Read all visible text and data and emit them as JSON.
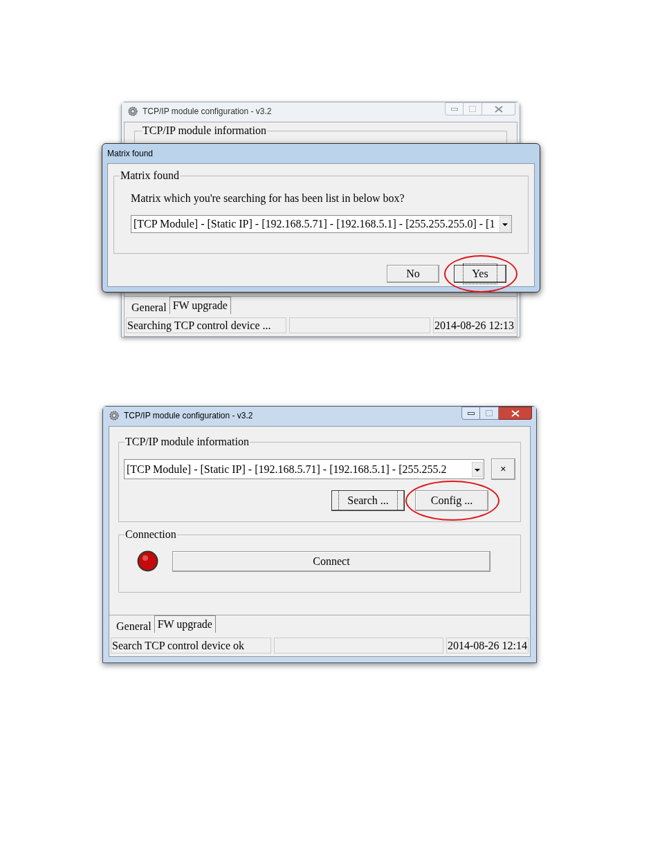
{
  "screenshot_1": {
    "window": {
      "title": "TCP/IP module configuration - v3.2",
      "active": false
    },
    "group_title": "TCP/IP module information",
    "dialog": {
      "title": "Matrix found",
      "group_title": "Matrix found",
      "message": "Matrix which you're searching for has been list in below box?",
      "dropdown_value": "[TCP Module] - [Static IP] - [192.168.5.71] - [192.168.5.1] - [255.255.255.0] - [1",
      "buttons": [
        {
          "label": "No",
          "focused": false,
          "highlighted": false
        },
        {
          "label": "Yes",
          "focused": true,
          "highlighted": true
        }
      ]
    },
    "tabs": [
      {
        "label": "General",
        "selected": true
      },
      {
        "label": "FW upgrade",
        "selected": false
      }
    ],
    "status_bar": {
      "message": "Searching TCP control device ...",
      "time": "2014-08-26 12:13"
    }
  },
  "screenshot_2": {
    "window": {
      "title": "TCP/IP module configuration - v3.2",
      "active": true
    },
    "info_group": {
      "title": "TCP/IP module information",
      "dropdown_value": "[TCP Module] - [Static IP] - [192.168.5.71] - [192.168.5.1] - [255.255.2",
      "clear_button": "×",
      "buttons": [
        {
          "label": "Search ...",
          "focused": true,
          "highlighted": false
        },
        {
          "label": "Config ...",
          "focused": false,
          "highlighted": true
        }
      ]
    },
    "connection_group": {
      "title": "Connection",
      "connected": false,
      "button": "Connect"
    },
    "tabs": [
      {
        "label": "General",
        "selected": true
      },
      {
        "label": "FW upgrade",
        "selected": false
      }
    ],
    "status_bar": {
      "message": "Search TCP control device ok",
      "time": "2014-08-26 12:14"
    }
  }
}
